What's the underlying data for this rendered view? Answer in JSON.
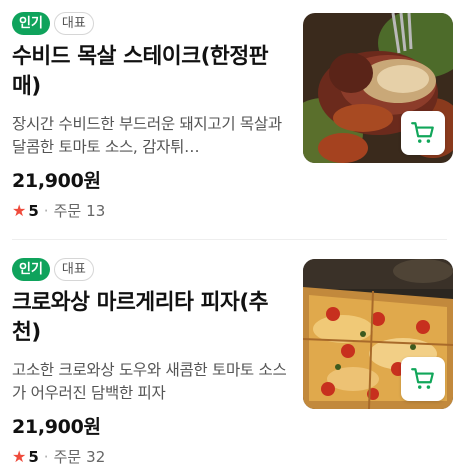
{
  "colors": {
    "badge_hot": "#0fa35c",
    "star": "#ef4b3c",
    "cart_icon": "#11a65a"
  },
  "items": [
    {
      "badges": {
        "hot": "인기",
        "rep": "대표"
      },
      "title": "수비드 목살 스테이크(한정판매)",
      "description": "장시간 수비드한 부드러운 돼지고기 목살과 달콤한 토마토 소스, 감자튀…",
      "price": "21,900원",
      "rating": "5",
      "order_label": "주문",
      "order_count": "13",
      "image_icon": "steak-photo",
      "cart_icon": "cart-icon"
    },
    {
      "badges": {
        "hot": "인기",
        "rep": "대표"
      },
      "title": "크로와상 마르게리타 피자(추천)",
      "description": "고소한 크로와상 도우와 새콤한 토마토 소스가 어우러진 담백한 피자",
      "price": "21,900원",
      "rating": "5",
      "order_label": "주문",
      "order_count": "32",
      "image_icon": "pizza-photo",
      "cart_icon": "cart-icon"
    }
  ]
}
